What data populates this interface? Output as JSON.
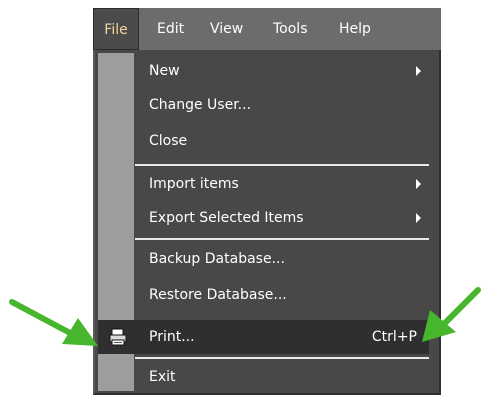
{
  "menubar": {
    "items": [
      {
        "label": "File"
      },
      {
        "label": "Edit"
      },
      {
        "label": "View"
      },
      {
        "label": "Tools"
      },
      {
        "label": "Help"
      }
    ]
  },
  "file_menu": {
    "items": [
      {
        "label": "New"
      },
      {
        "label": "Change User..."
      },
      {
        "label": "Close"
      },
      {
        "label": "Import items"
      },
      {
        "label": "Export Selected Items"
      },
      {
        "label": "Backup Database..."
      },
      {
        "label": "Restore Database..."
      },
      {
        "label": "Print...",
        "shortcut": "Ctrl+P"
      },
      {
        "label": "Exit"
      }
    ]
  },
  "colors": {
    "menubar_bg": "#6c6c6c",
    "menu_bg": "#484848",
    "highlight_bg": "#2f2f2f",
    "gutter": "#9d9d9d",
    "annotation_arrow": "#48b62c"
  },
  "icons": {
    "submenu": "chevron-right-icon",
    "print": "printer-icon",
    "annotation": "green-arrow-icon"
  }
}
